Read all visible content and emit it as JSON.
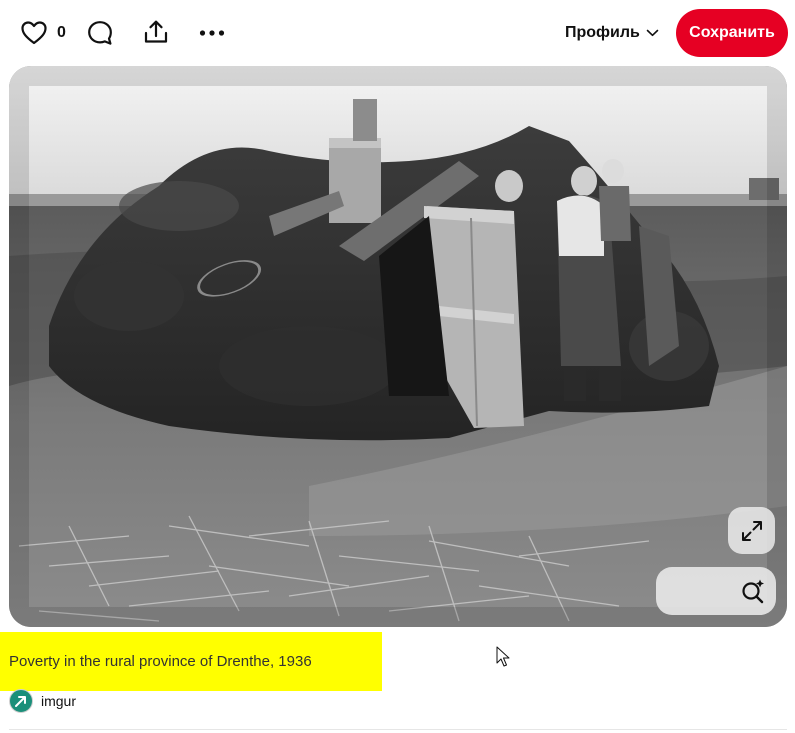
{
  "toolbar": {
    "like_count": "0",
    "profile_label": "Профиль",
    "save_label": "Сохранить"
  },
  "pin": {
    "image_alt": "Poverty in the rural province of Drenthe, 1936",
    "caption": "Poverty in the rural province of Drenthe, 1936",
    "source_name": "imgur"
  },
  "colors": {
    "save_button": "#e60023",
    "caption_highlight": "#ffff00"
  },
  "icons": [
    "heart-icon",
    "comment-icon",
    "share-icon",
    "more-icon",
    "chevron-down-icon",
    "expand-icon",
    "visual-search-icon",
    "cursor-icon"
  ]
}
